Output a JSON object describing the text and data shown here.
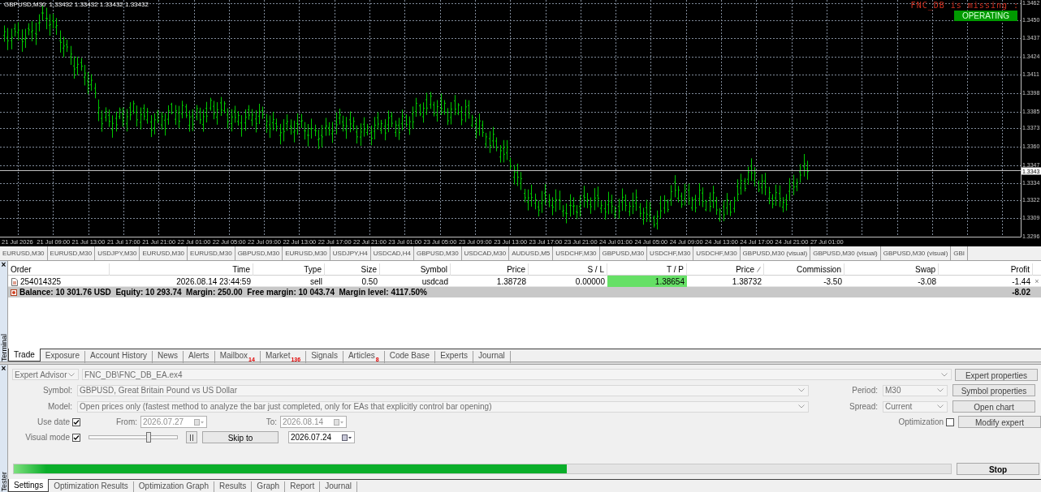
{
  "chart": {
    "symbol": "GBPUSD,M30",
    "quote": "1.33432 1.33432 1.33432 1.33432",
    "warning": "FNC_DB is missing :",
    "status_badge": "OPERATING",
    "price_labels": [
      "1.3462",
      "1.3450",
      "1.3437",
      "1.3424",
      "1.3411",
      "1.3398",
      "1.3385",
      "1.3373",
      "1.3360",
      "1.3347",
      "1.3334",
      "1.3322",
      "1.3309",
      "1.3296"
    ],
    "current_price": "1.3343",
    "time_labels": [
      "21 Jul 2026",
      "21 Jul 09:00",
      "21 Jul 13:00",
      "21 Jul 17:00",
      "21 Jul 21:00",
      "22 Jul 01:00",
      "22 Jul 05:00",
      "22 Jul 09:00",
      "22 Jul 13:00",
      "22 Jul 17:00",
      "22 Jul 21:00",
      "23 Jul 01:00",
      "23 Jul 05:00",
      "23 Jul 09:00",
      "23 Jul 13:00",
      "23 Jul 17:00",
      "23 Jul 21:00",
      "24 Jul 01:00",
      "24 Jul 05:00",
      "24 Jul 09:00",
      "24 Jul 13:00",
      "24 Jul 17:00",
      "24 Jul 21:00",
      "27 Jul 01:00"
    ]
  },
  "chart_tabs": [
    {
      "label": "EURUSD,M30",
      "selected": false
    },
    {
      "label": "EURUSD,M30",
      "selected": false
    },
    {
      "label": "USDJPY,M30",
      "selected": false
    },
    {
      "label": "EURUSD,M30",
      "selected": false
    },
    {
      "label": "EURUSD,M30",
      "selected": false
    },
    {
      "label": "GBPUSD,M30",
      "selected": false
    },
    {
      "label": "EURUSD,M30",
      "selected": false
    },
    {
      "label": "USDJPY,H4",
      "selected": false
    },
    {
      "label": "USDCAD,H4",
      "selected": false
    },
    {
      "label": "GBPUSD,M30",
      "selected": false
    },
    {
      "label": "USDCAD,M30",
      "selected": false
    },
    {
      "label": "AUDUSD,M5",
      "selected": false
    },
    {
      "label": "USDCHF,M30",
      "selected": false
    },
    {
      "label": "GBPUSD,M30",
      "selected": false
    },
    {
      "label": "USDCHF,M30",
      "selected": false
    },
    {
      "label": "USDCHF,M30",
      "selected": false
    },
    {
      "label": "GBPUSD,M30 (visual)",
      "selected": false
    },
    {
      "label": "GBPUSD,M30 (visual)",
      "selected": false
    },
    {
      "label": "GBPUSD,M30 (visual)",
      "selected": false
    },
    {
      "label": "GBI",
      "selected": false
    }
  ],
  "terminal": {
    "title": "Terminal",
    "close": "×",
    "columns": [
      "Order",
      "Time",
      "Type",
      "Size",
      "Symbol",
      "Price",
      "S / L",
      "T / P",
      "Price",
      "Commission",
      "Swap",
      "Profit"
    ],
    "rows": [
      {
        "cells": [
          {
            "text": "254014325",
            "highlighted": false
          },
          {
            "text": "2026.08.14 23:44:59",
            "highlighted": false
          },
          {
            "text": "sell",
            "highlighted": false
          },
          {
            "text": "0.50",
            "highlighted": false
          },
          {
            "text": "usdcad",
            "highlighted": false
          },
          {
            "text": "1.38728",
            "highlighted": false
          },
          {
            "text": "0.00000",
            "highlighted": false
          },
          {
            "text": "1.38654",
            "highlighted": true
          },
          {
            "text": "1.38732",
            "highlighted": false
          },
          {
            "text": "-3.50",
            "highlighted": false
          },
          {
            "text": "-3.08",
            "highlighted": false
          },
          {
            "text": "-1.44",
            "highlighted": false
          }
        ],
        "close": "×"
      }
    ],
    "balance": {
      "summary": "Balance: 10 301.76 USD  Equity: 10 293.74  Margin: 250.00  Free margin: 10 043.74  Margin level: 4117.50%",
      "total": "-8.02"
    },
    "tabs": [
      {
        "label": "Trade",
        "selected": true
      },
      {
        "label": "Exposure",
        "selected": false
      },
      {
        "label": "Account History",
        "selected": false
      },
      {
        "label": "News",
        "selected": false
      },
      {
        "label": "Alerts",
        "selected": false
      },
      {
        "label": "Mailbox",
        "badge": "14",
        "selected": false
      },
      {
        "label": "Market",
        "badge": "136",
        "selected": false
      },
      {
        "label": "Signals",
        "selected": false
      },
      {
        "label": "Articles",
        "badge": "8",
        "selected": false
      },
      {
        "label": "Code Base",
        "selected": false
      },
      {
        "label": "Experts",
        "selected": false
      },
      {
        "label": "Journal",
        "selected": false
      }
    ]
  },
  "tester": {
    "title": "Tester",
    "close": "×",
    "mode": "Expert Advisor",
    "expert": "FNC_DB\\FNC_DB_EA.ex4",
    "symbol_label": "Symbol:",
    "symbol": "GBPUSD, Great Britain Pound vs US Dollar",
    "model_label": "Model:",
    "model": "Open prices only (fastest method to analyze the bar just completed, only for EAs that explicitly control bar opening)",
    "period_label": "Period:",
    "period": "M30",
    "spread_label": "Spread:",
    "spread": "Current",
    "use_date": {
      "label": "Use date",
      "checked": true
    },
    "from_label": "From:",
    "from": "2026.07.27",
    "to_label": "To:",
    "to": "2026.08.14",
    "visual_mode": {
      "label": "Visual mode",
      "checked": true
    },
    "speed": {
      "level": 0.67
    },
    "skip_label": "Skip to",
    "skip_date": "2026.07.24",
    "optimization": {
      "label": "Optimization",
      "checked": false
    },
    "buttons": [
      "Expert properties",
      "Symbol properties",
      "Open chart",
      "Modify expert"
    ],
    "progress": {
      "level": 0.59
    },
    "stop": "Stop",
    "tabs": [
      {
        "label": "Settings",
        "selected": true
      },
      {
        "label": "Optimization Results",
        "selected": false
      },
      {
        "label": "Optimization Graph",
        "selected": false
      },
      {
        "label": "Results",
        "selected": false
      },
      {
        "label": "Graph",
        "selected": false
      },
      {
        "label": "Report",
        "selected": false
      },
      {
        "label": "Journal",
        "selected": false
      }
    ]
  }
}
